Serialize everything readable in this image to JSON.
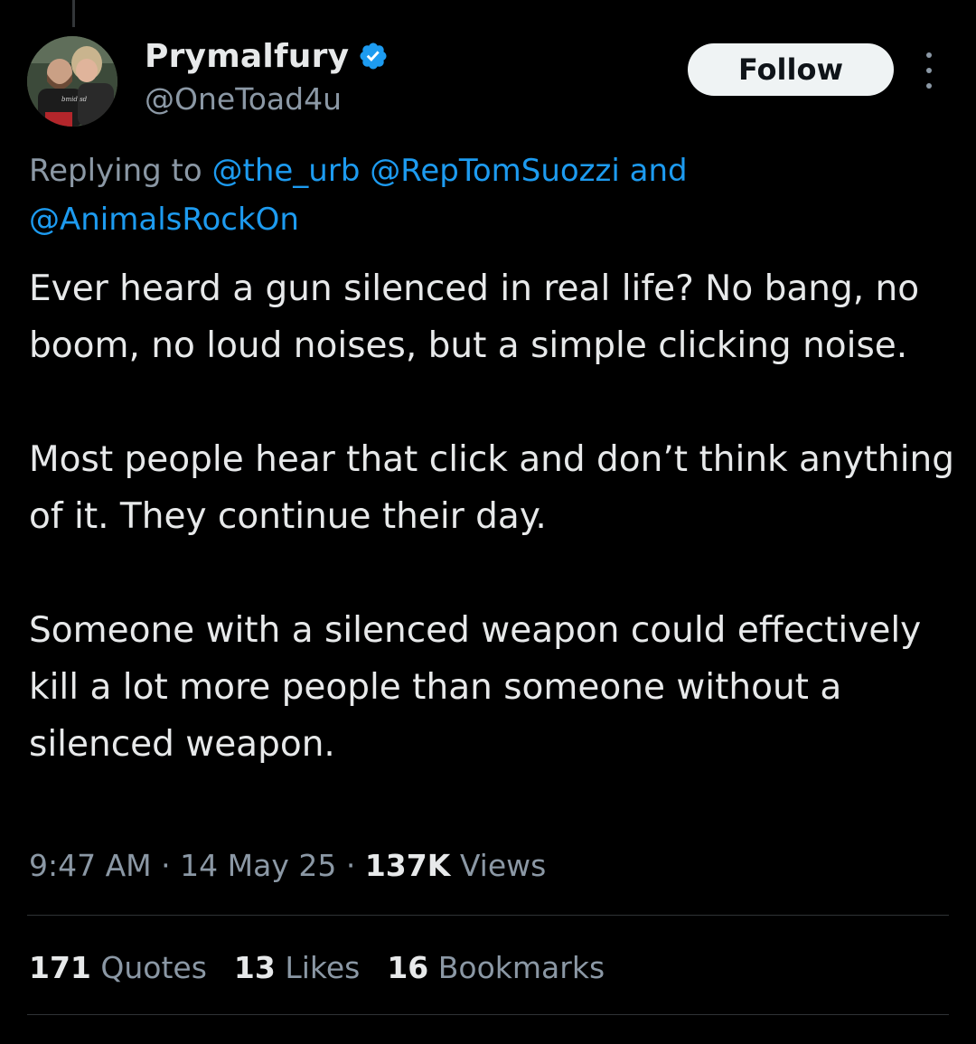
{
  "author": {
    "display_name": "Prymalfury",
    "handle": "@OneToad4u",
    "verified": true,
    "avatar_shirt_text": "bmid sd"
  },
  "actions": {
    "follow_label": "Follow"
  },
  "reply_context": {
    "prefix": "Replying to",
    "mentions": [
      "@the_urb",
      "@RepTomSuozzi"
    ],
    "joiner": "and",
    "last_mention": "@AnimalsRockOn"
  },
  "tweet": {
    "paragraphs": [
      "Ever heard a gun silenced in real life? No bang, no boom, no loud noises, but a simple clicking noise.",
      "Most people hear that click and don’t think anything of it. They continue their day.",
      "Someone with a silenced weapon could effectively kill a lot more people than someone without a silenced weapon."
    ]
  },
  "meta": {
    "time": "9:47 AM",
    "date": "14 May 25",
    "separator": "·",
    "views_count": "137K",
    "views_label": "Views"
  },
  "stats": [
    {
      "count": "171",
      "label": "Quotes"
    },
    {
      "count": "13",
      "label": "Likes"
    },
    {
      "count": "16",
      "label": "Bookmarks"
    }
  ],
  "colors": {
    "background": "#000000",
    "primary_text": "#e7e9ea",
    "secondary_text": "#8b98a5",
    "accent": "#1d9bf0",
    "divider": "#2f3336",
    "follow_button_bg": "#eff3f4"
  }
}
